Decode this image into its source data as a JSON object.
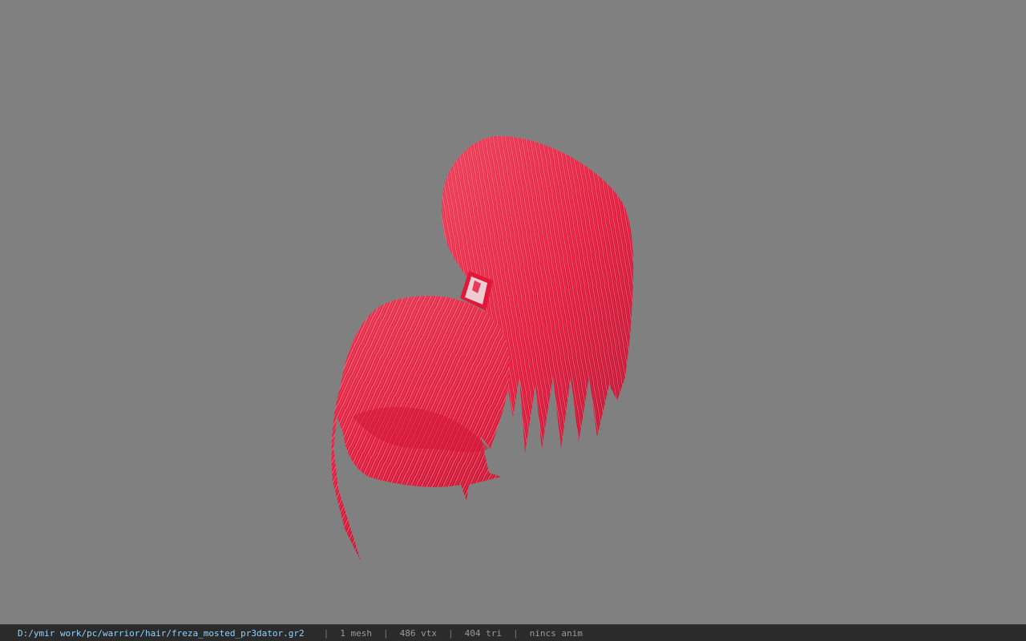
{
  "viewer": {
    "background_color": "#808080",
    "model_color": "#e3173a",
    "highlight_color": "#f2c2cb",
    "band_color": "#e8e8e8"
  },
  "status": {
    "file_path": "D:/ymir work/pc/warrior/hair/freza_mosted_pr3dator.gr2",
    "separator": "|",
    "mesh_count": "1 mesh",
    "vertex_count": "486 vtx",
    "triangle_count": "404 tri",
    "anim_status": "nincs anim"
  }
}
